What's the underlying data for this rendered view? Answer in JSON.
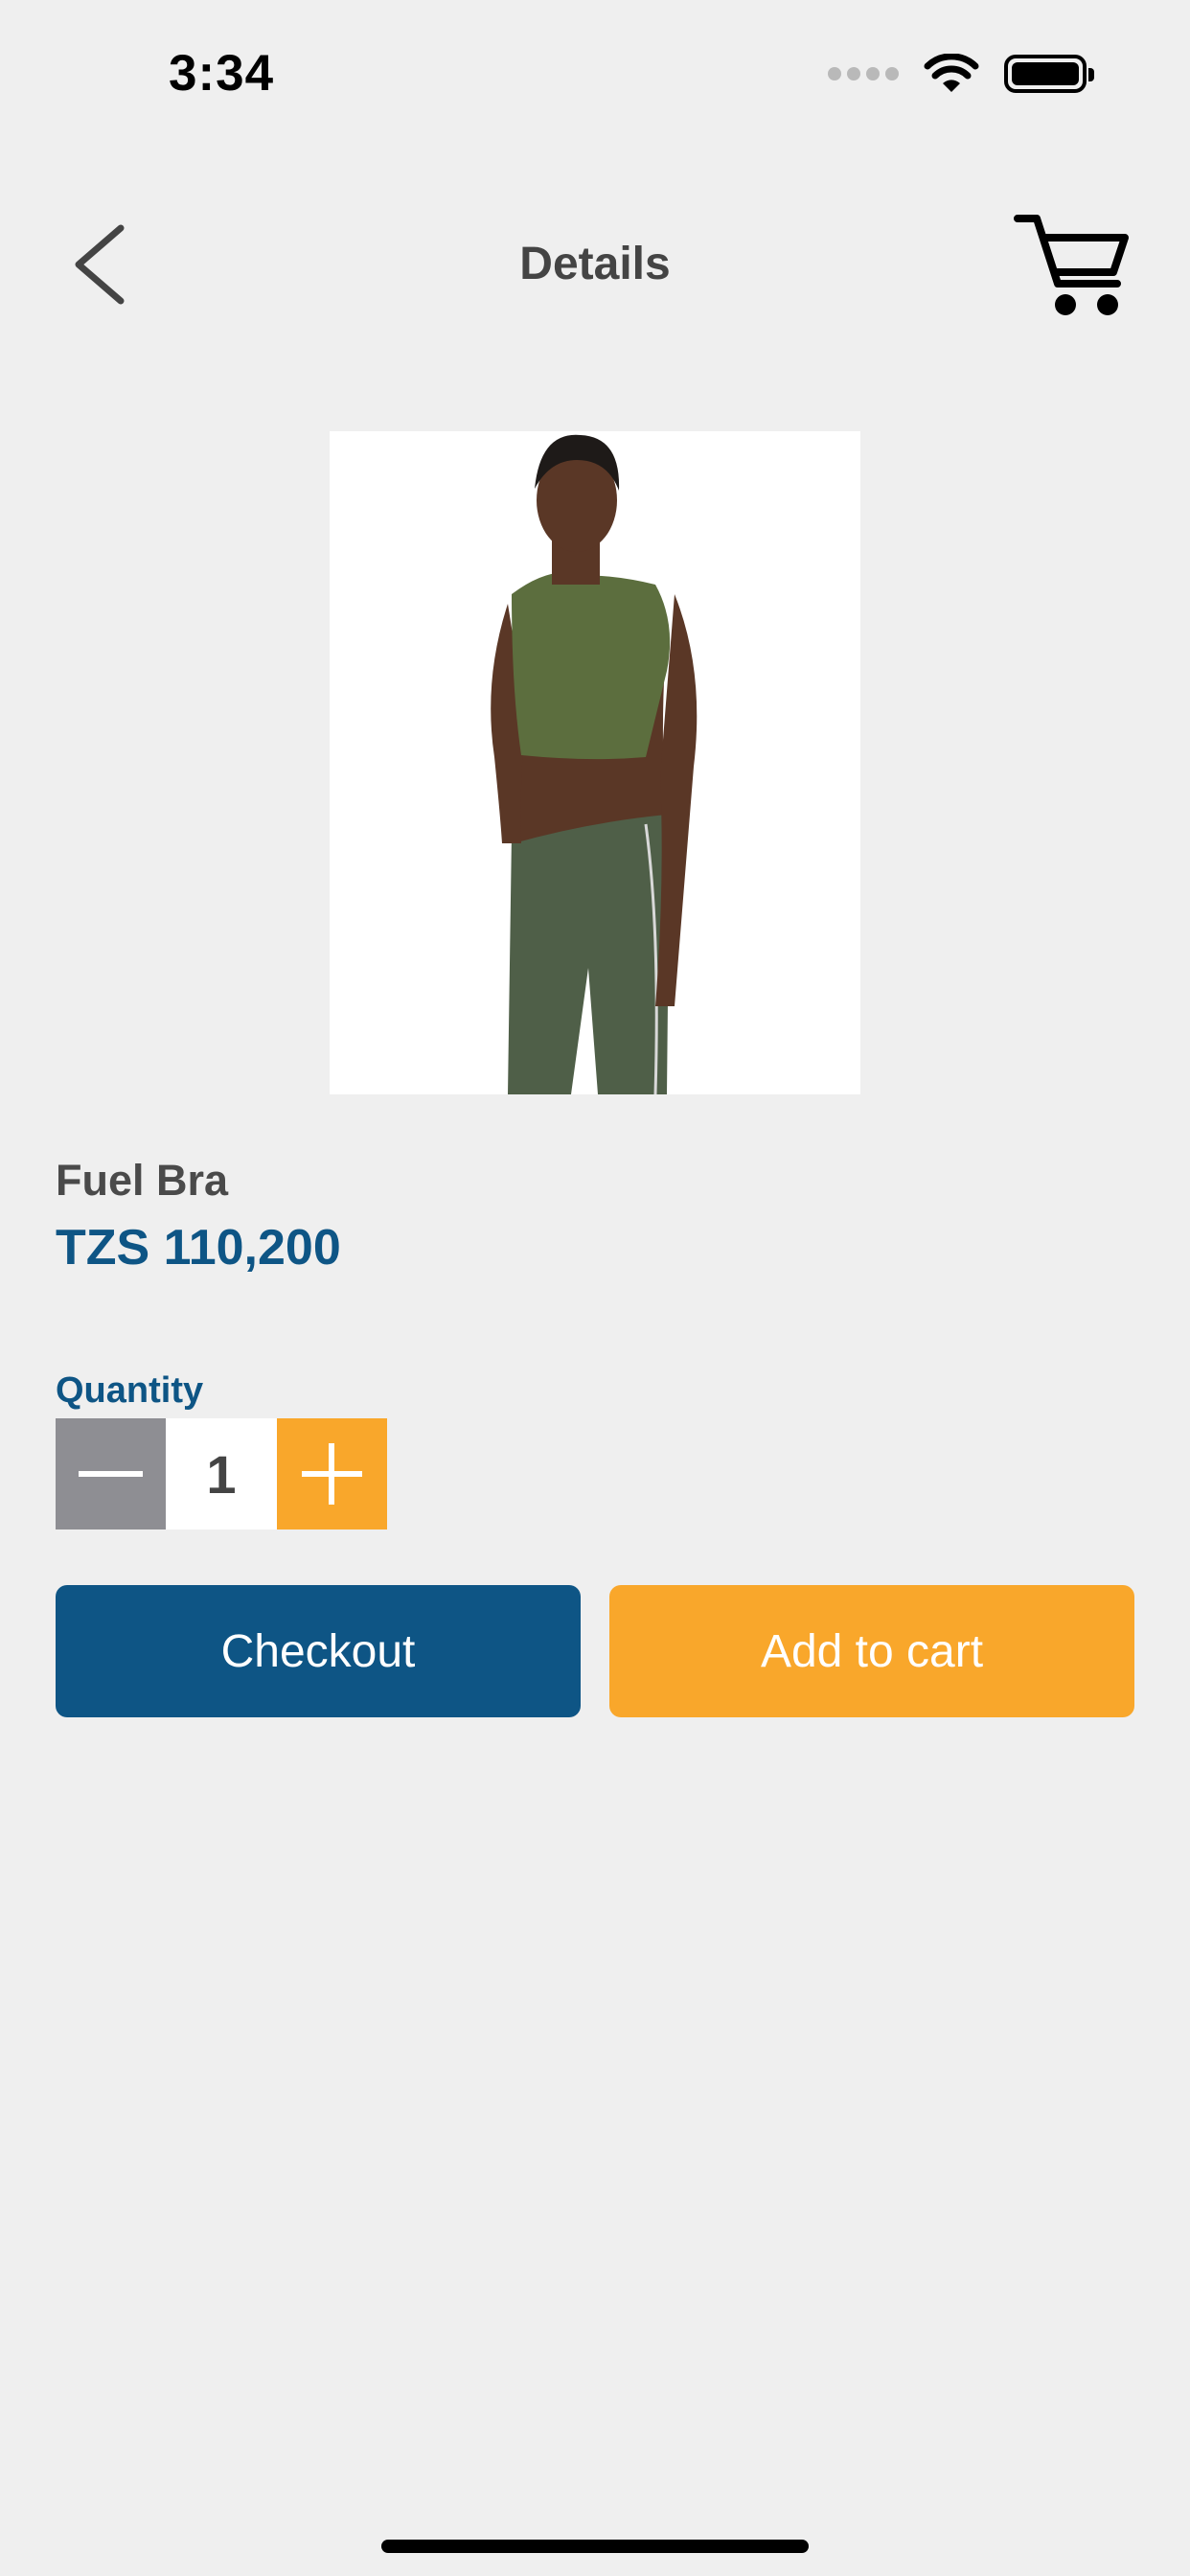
{
  "status_bar": {
    "time": "3:34"
  },
  "header": {
    "title": "Details"
  },
  "product": {
    "name": "Fuel Bra",
    "price": "TZS 110,200"
  },
  "quantity": {
    "label": "Quantity",
    "value": "1"
  },
  "actions": {
    "checkout_label": "Checkout",
    "add_to_cart_label": "Add to cart"
  },
  "colors": {
    "primary": "#0e5585",
    "accent": "#f9a72b",
    "stepper_minus": "#8e8e93",
    "background": "#efefef"
  },
  "icons": {
    "back": "chevron-left-icon",
    "cart": "cart-icon",
    "wifi": "wifi-icon",
    "battery": "battery-icon",
    "minus": "minus-icon",
    "plus": "plus-icon"
  }
}
